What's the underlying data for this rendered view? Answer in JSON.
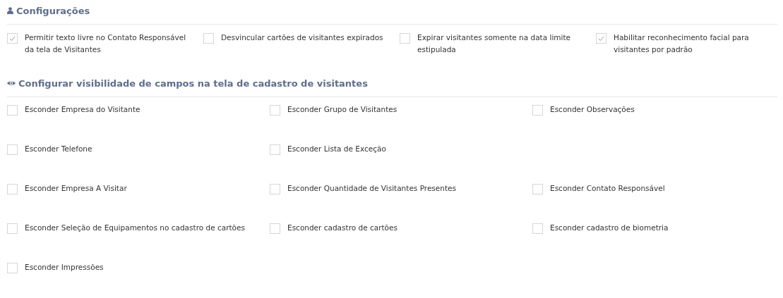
{
  "settings": {
    "title": "Configurações",
    "options": [
      {
        "label": "Permitir texto livre no Contato Responsável da tela de Visitantes",
        "checked": true
      },
      {
        "label": "Desvincular cartões de visitantes expirados",
        "checked": false
      },
      {
        "label": "Expirar visitantes somente na data limite estipulada",
        "checked": false
      },
      {
        "label": "Habilitar reconhecimento facial para visitantes por padrão",
        "checked": true
      }
    ]
  },
  "visibility": {
    "title": "Configurar visibilidade de campos na tela de cadastro de visitantes",
    "rows": [
      [
        {
          "label": "Esconder Empresa do Visitante",
          "checked": false
        },
        {
          "label": "Esconder Grupo de Visitantes",
          "checked": false
        },
        {
          "label": "Esconder Observações",
          "checked": false
        }
      ],
      [
        {
          "label": "Esconder Telefone",
          "checked": false
        },
        {
          "label": "Esconder Lista de Exceção",
          "checked": false
        }
      ],
      [
        {
          "label": "Esconder Empresa A Visitar",
          "checked": false
        },
        {
          "label": "Esconder Quantidade de Visitantes Presentes",
          "checked": false
        },
        {
          "label": "Esconder Contato Responsável",
          "checked": false
        }
      ],
      [
        {
          "label": "Esconder Seleção de Equipamentos no cadastro de cartões",
          "checked": false
        },
        {
          "label": "Esconder cadastro de cartões",
          "checked": false
        },
        {
          "label": "Esconder cadastro de biometria",
          "checked": false
        }
      ],
      [
        {
          "label": "Esconder Impressões",
          "checked": false
        }
      ]
    ]
  }
}
